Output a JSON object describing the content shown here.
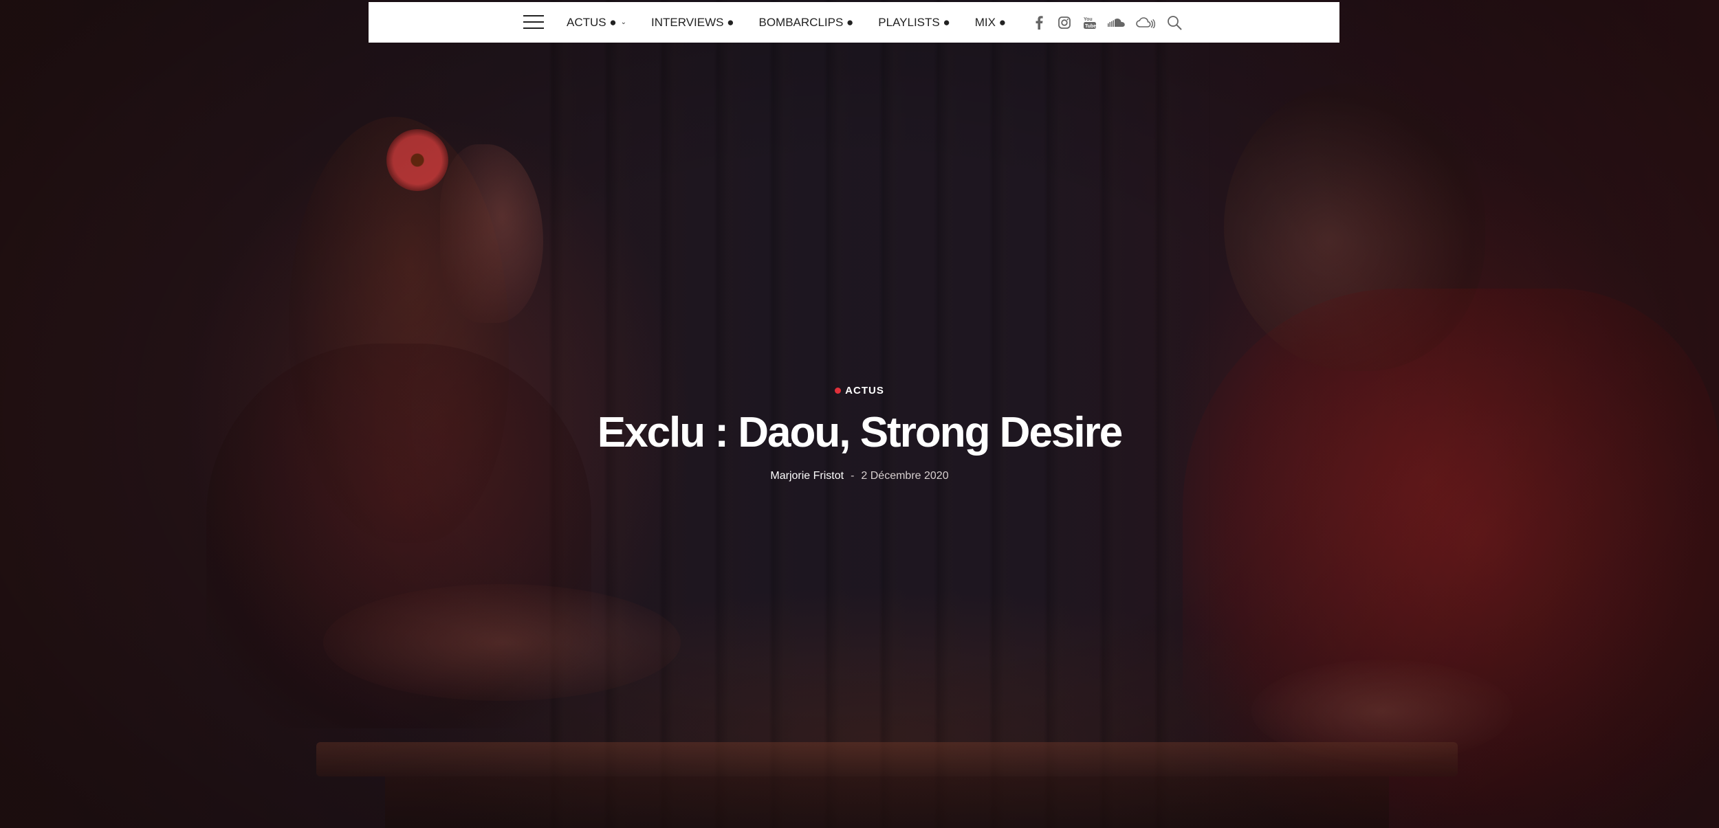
{
  "nav": {
    "menu": [
      {
        "label": "ACTUS ●",
        "has_dropdown": true
      },
      {
        "label": "INTERVIEWS ●",
        "has_dropdown": false
      },
      {
        "label": "BOMBARCLIPS ●",
        "has_dropdown": false
      },
      {
        "label": "PLAYLISTS ●",
        "has_dropdown": false
      },
      {
        "label": "MIX ●",
        "has_dropdown": false
      }
    ],
    "dropdown_glyph": "⌄",
    "social_icons": [
      "facebook-icon",
      "instagram-icon",
      "youtube-icon",
      "soundcloud-icon",
      "mixcloud-icon"
    ],
    "search_icon": "search-icon",
    "menu_icon": "hamburger-menu-icon"
  },
  "article": {
    "category": "ACTUS",
    "title": "Exclu : Daou, Strong Desire",
    "author": "Marjorie Fristot",
    "separator": "-",
    "date": "2 Décembre 2020"
  },
  "colors": {
    "accent": "#e0303a",
    "nav_background": "#ffffff",
    "nav_text": "#222222",
    "icon_gray": "#666666",
    "hero_text": "#ffffff"
  }
}
